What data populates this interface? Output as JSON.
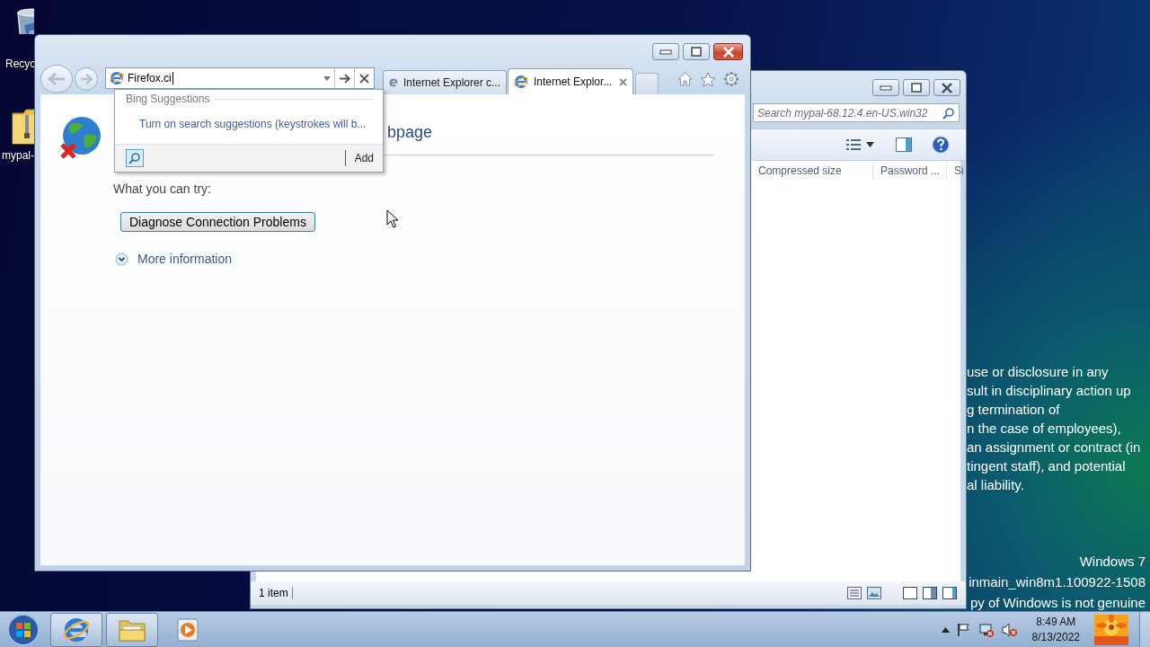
{
  "desktop": {
    "icons": [
      {
        "kind": "recycle",
        "label": "Recyc"
      },
      {
        "kind": "zip",
        "label": "mypal-"
      }
    ],
    "notice_lines": [
      "use or disclosure in any",
      "sult in disciplinary action up",
      "g termination of",
      "n the case of employees),",
      "an assignment or contract (in",
      "tingent staff), and potential",
      "al liability."
    ],
    "build_lines": [
      "Windows 7",
      "inmain_win8m1.100922-1508",
      "py of Windows is not genuine"
    ]
  },
  "explorer": {
    "search": {
      "placeholder": "Search mypal-68.12.4.en-US.win32"
    },
    "columns": [
      "Compressed size",
      "Password ...",
      "Si"
    ],
    "status": "1 item"
  },
  "browser": {
    "address": {
      "value": "Firefox.ci"
    },
    "tabs": [
      {
        "label": "Internet Explorer c...",
        "selected": false
      },
      {
        "label": "Internet Explor...",
        "selected": true
      }
    ],
    "suggestions": {
      "header": "Bing Suggestions",
      "items": [
        "Turn on search suggestions (keystrokes will b..."
      ],
      "add": "Add"
    },
    "page": {
      "heading": "bpage",
      "try_label": "What you can try:",
      "button": "Diagnose Connection Problems",
      "more": "More information"
    }
  },
  "taskbar": {
    "apps": [
      {
        "kind": "ie",
        "running": true
      },
      {
        "kind": "folder",
        "running": true
      },
      {
        "kind": "media",
        "running": false
      }
    ],
    "time": "8:49 AM",
    "date": "8/13/2022"
  }
}
